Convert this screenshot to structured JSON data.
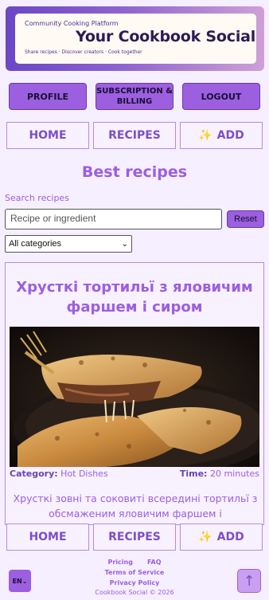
{
  "banner": {
    "kicker": "Community Cooking Platform",
    "title": "Your Cookbook Social",
    "tagline": "Share recipes · Discover creators · Cook together"
  },
  "account_nav": {
    "profile": "PROFILE",
    "subscription": "SUBSCRIPTION & BILLING",
    "logout": "LOGOUT"
  },
  "main_nav": {
    "home": "HOME",
    "recipes": "RECIPES",
    "add": "ADD",
    "add_icon": "sparkles-icon"
  },
  "section_title": "Best recipes",
  "search": {
    "label": "Search recipes",
    "placeholder": "Recipe or ingredient",
    "reset": "Reset"
  },
  "category_select": {
    "selected": "All categories"
  },
  "recipe": {
    "title": "Хрусткі тортильї з яловичим фаршем і сиром",
    "category_label": "Category:",
    "category": "Hot Dishes",
    "time_label": "Time:",
    "time": "20 minutes",
    "description": "Хрусткі зовні та соковиті всередині тортильї з обсмаженим яловичим фаршем і розплавленим"
  },
  "footer": {
    "pricing": "Pricing",
    "faq": "FAQ",
    "terms": "Terms of Service",
    "privacy": "Privacy Policy",
    "copyright": "Cookbook Social © 2026",
    "language": "EN",
    "scroll_top_icon": "arrow-up-icon"
  },
  "colors": {
    "accent": "#9b5fe0",
    "background": "#f6efff",
    "text": "#7a55c9"
  }
}
